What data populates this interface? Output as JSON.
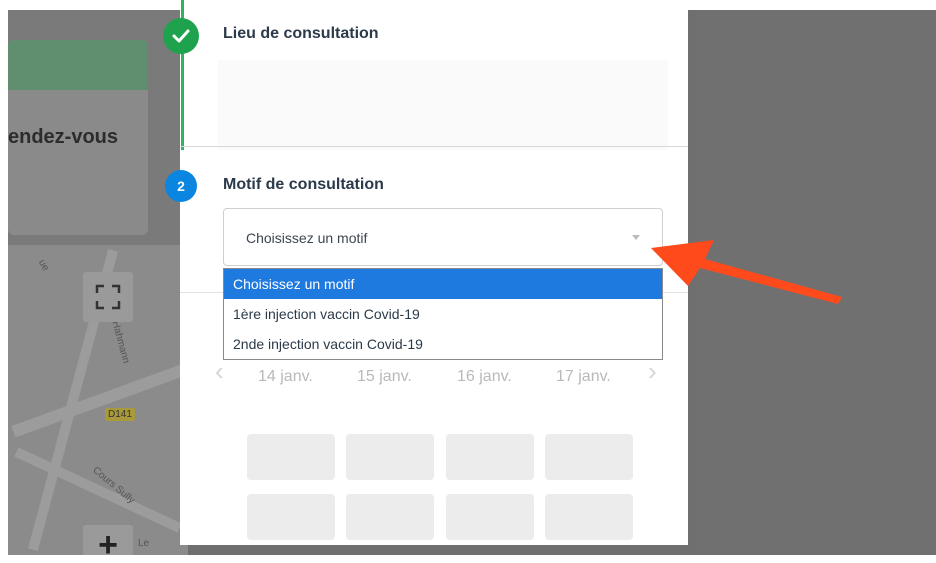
{
  "background": {
    "card_text": "endez-vous",
    "map_labels": [
      "ue",
      "ue Hahmann",
      "Cours Sully",
      "Le"
    ],
    "road_badge": "D141",
    "fullscreen_icon": "fullscreen-icon",
    "zoom_label": "+"
  },
  "step1": {
    "title": "Lieu de consultation",
    "icon": "check-icon"
  },
  "step2": {
    "number": "2",
    "title": "Motif de consultation",
    "select": {
      "value": "Choisissez un motif",
      "options": [
        "Choisissez un motif",
        "1ère injection vaccin Covid-19",
        "2nde injection vaccin Covid-19"
      ],
      "selected_index": 0
    }
  },
  "calendar": {
    "prev_label": "‹",
    "next_label": "›",
    "dates": [
      "14 janv.",
      "15 janv.",
      "16 janv.",
      "17 janv."
    ]
  },
  "colors": {
    "success": "#1ea24d",
    "step_active": "#0b86e0",
    "option_selected": "#1f7ae0",
    "annotation_arrow": "#ff4a1c"
  }
}
